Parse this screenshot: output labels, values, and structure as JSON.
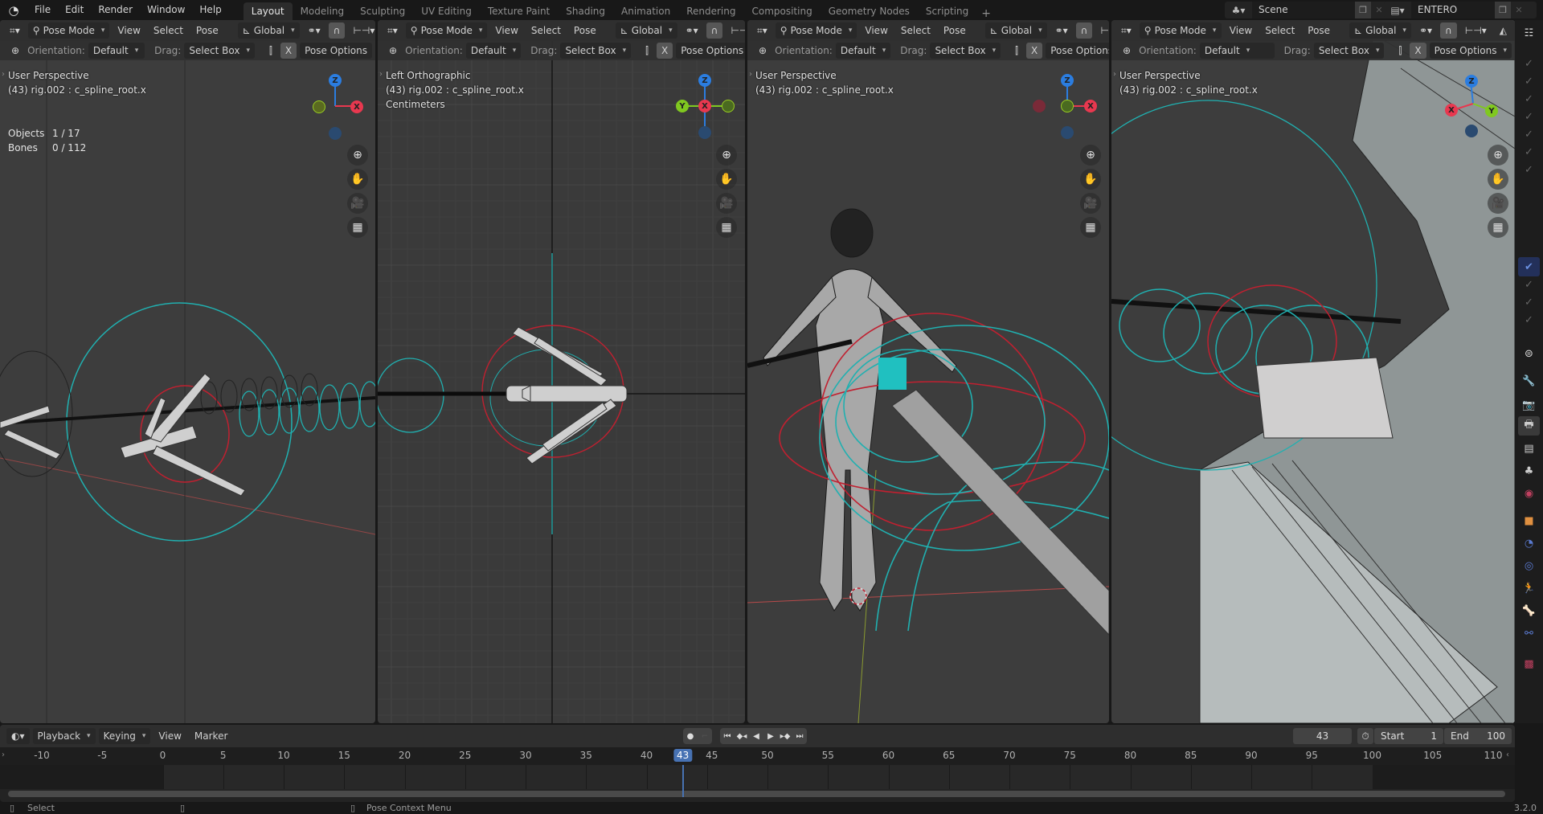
{
  "topbar": {
    "menus": [
      "File",
      "Edit",
      "Render",
      "Window",
      "Help"
    ],
    "workspaces": [
      "Layout",
      "Modeling",
      "Sculpting",
      "UV Editing",
      "Texture Paint",
      "Shading",
      "Animation",
      "Rendering",
      "Compositing",
      "Geometry Nodes",
      "Scripting"
    ],
    "active_workspace": "Layout",
    "add_workspace": "+",
    "scene_name": "Scene",
    "view_layer_name": "ENTERO"
  },
  "viewport_header": {
    "mode": "Pose Mode",
    "menus": [
      "View",
      "Select",
      "Pose"
    ],
    "transform_orientation": "Global",
    "orientation_label": "Orientation:",
    "orientation_value": "Default",
    "drag_label": "Drag:",
    "drag_value": "Select Box",
    "mirror_x": "X",
    "pose_options": "Pose Options"
  },
  "viewports": [
    {
      "view_name": "User Perspective",
      "active_info": "(43) rig.002 : c_spline_root.x",
      "extra": "",
      "stats": [
        {
          "label": "Objects",
          "value": "1 / 17"
        },
        {
          "label": "Bones",
          "value": "0 / 112"
        }
      ],
      "gizmo": [
        "Z",
        "X"
      ]
    },
    {
      "view_name": "Left Orthographic",
      "active_info": "(43) rig.002 : c_spline_root.x",
      "extra": "Centimeters",
      "gizmo": [
        "Z",
        "Y",
        "X"
      ]
    },
    {
      "view_name": "User Perspective",
      "active_info": "(43) rig.002 : c_spline_root.x",
      "extra": "",
      "gizmo": [
        "Z",
        "X"
      ]
    },
    {
      "view_name": "User Perspective",
      "active_info": "(43) rig.002 : c_spline_root.x",
      "extra": "",
      "gizmo": [
        "Z",
        "X",
        "Y"
      ]
    }
  ],
  "nav_icons": [
    "zoom-icon",
    "pan-hand-icon",
    "camera-icon",
    "perspective-grid-icon"
  ],
  "properties_tabs": [
    "tool",
    "render",
    "output",
    "view-layer",
    "scene",
    "world",
    "object",
    "modifiers",
    "physics",
    "object-constraints",
    "object-data-armature",
    "bone",
    "bone-constraints",
    "texture"
  ],
  "timeline": {
    "menus": [
      "Playback",
      "Keying",
      "View",
      "Marker"
    ],
    "current_frame": 43,
    "start_label": "Start",
    "start": 1,
    "end_label": "End",
    "end": 100,
    "ticks": [
      -10,
      -5,
      0,
      5,
      10,
      15,
      20,
      25,
      30,
      35,
      40,
      45,
      50,
      55,
      60,
      65,
      70,
      75,
      80,
      85,
      90,
      95,
      100,
      105,
      110
    ]
  },
  "statusbar": {
    "left_action": "Select",
    "right_action": "Pose Context Menu",
    "version": "3.2.0"
  },
  "colors": {
    "axis_x": "#e8384f",
    "axis_y": "#80c820",
    "axis_z": "#2b7de0",
    "accent": "#4772b3",
    "bone_red": "#d02030",
    "bone_cyan": "#20c0c0"
  }
}
